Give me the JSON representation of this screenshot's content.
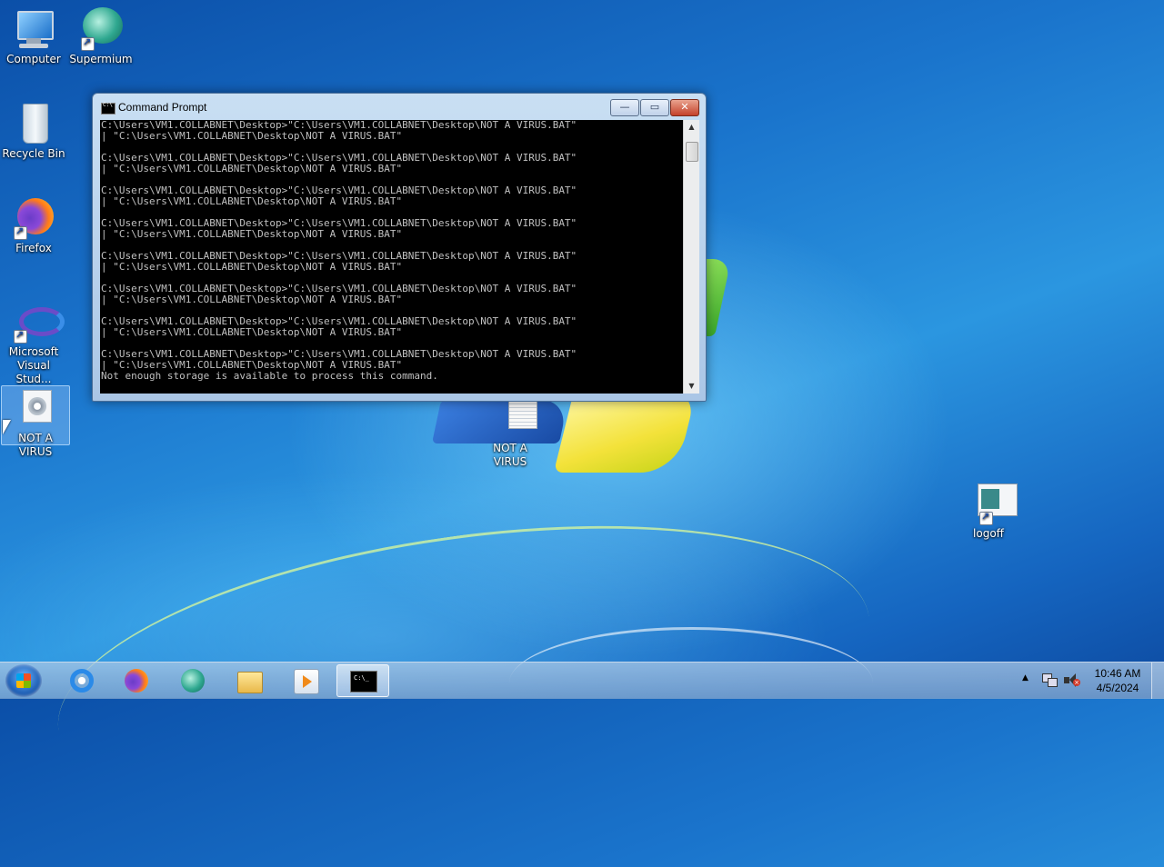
{
  "desktop": {
    "icons": [
      {
        "label": "Computer",
        "icon": "computer-icon"
      },
      {
        "label": "Supermium",
        "icon": "supermium-icon"
      },
      {
        "label": "Recycle Bin",
        "icon": "recycle-bin-icon"
      },
      {
        "label": "Firefox",
        "icon": "firefox-icon"
      },
      {
        "label": "Microsoft Visual Stud...",
        "icon": "visual-studio-icon"
      },
      {
        "label": "NOT A VIRUS",
        "icon": "batch-file-icon"
      },
      {
        "label": "NOT A VIRUS",
        "icon": "text-file-icon"
      },
      {
        "label": "logoff",
        "icon": "logoff-icon"
      }
    ]
  },
  "cmd_window": {
    "title": "Command Prompt",
    "buttons": {
      "minimize": "—",
      "maximize": "▭",
      "close": "✕"
    },
    "console_text": "C:\\Users\\VM1.COLLABNET\\Desktop>\"C:\\Users\\VM1.COLLABNET\\Desktop\\NOT A VIRUS.BAT\"\n| \"C:\\Users\\VM1.COLLABNET\\Desktop\\NOT A VIRUS.BAT\"\n\nC:\\Users\\VM1.COLLABNET\\Desktop>\"C:\\Users\\VM1.COLLABNET\\Desktop\\NOT A VIRUS.BAT\"\n| \"C:\\Users\\VM1.COLLABNET\\Desktop\\NOT A VIRUS.BAT\"\n\nC:\\Users\\VM1.COLLABNET\\Desktop>\"C:\\Users\\VM1.COLLABNET\\Desktop\\NOT A VIRUS.BAT\"\n| \"C:\\Users\\VM1.COLLABNET\\Desktop\\NOT A VIRUS.BAT\"\n\nC:\\Users\\VM1.COLLABNET\\Desktop>\"C:\\Users\\VM1.COLLABNET\\Desktop\\NOT A VIRUS.BAT\"\n| \"C:\\Users\\VM1.COLLABNET\\Desktop\\NOT A VIRUS.BAT\"\n\nC:\\Users\\VM1.COLLABNET\\Desktop>\"C:\\Users\\VM1.COLLABNET\\Desktop\\NOT A VIRUS.BAT\"\n| \"C:\\Users\\VM1.COLLABNET\\Desktop\\NOT A VIRUS.BAT\"\n\nC:\\Users\\VM1.COLLABNET\\Desktop>\"C:\\Users\\VM1.COLLABNET\\Desktop\\NOT A VIRUS.BAT\"\n| \"C:\\Users\\VM1.COLLABNET\\Desktop\\NOT A VIRUS.BAT\"\n\nC:\\Users\\VM1.COLLABNET\\Desktop>\"C:\\Users\\VM1.COLLABNET\\Desktop\\NOT A VIRUS.BAT\"\n| \"C:\\Users\\VM1.COLLABNET\\Desktop\\NOT A VIRUS.BAT\"\n\nC:\\Users\\VM1.COLLABNET\\Desktop>\"C:\\Users\\VM1.COLLABNET\\Desktop\\NOT A VIRUS.BAT\"\n| \"C:\\Users\\VM1.COLLABNET\\Desktop\\NOT A VIRUS.BAT\"\nNot enough storage is available to process this command."
  },
  "taskbar": {
    "items": [
      {
        "icon": "internet-explorer-icon"
      },
      {
        "icon": "firefox-icon"
      },
      {
        "icon": "supermium-icon"
      },
      {
        "icon": "file-explorer-icon"
      },
      {
        "icon": "media-player-icon"
      },
      {
        "icon": "command-prompt-icon",
        "active": true
      }
    ],
    "tray": {
      "show_hidden_icon": "▲",
      "time": "10:46 AM",
      "date": "4/5/2024"
    }
  },
  "colors": {
    "console_bg": "#000000",
    "console_fg": "#c0c0c0",
    "close_button": "#c4412a"
  }
}
